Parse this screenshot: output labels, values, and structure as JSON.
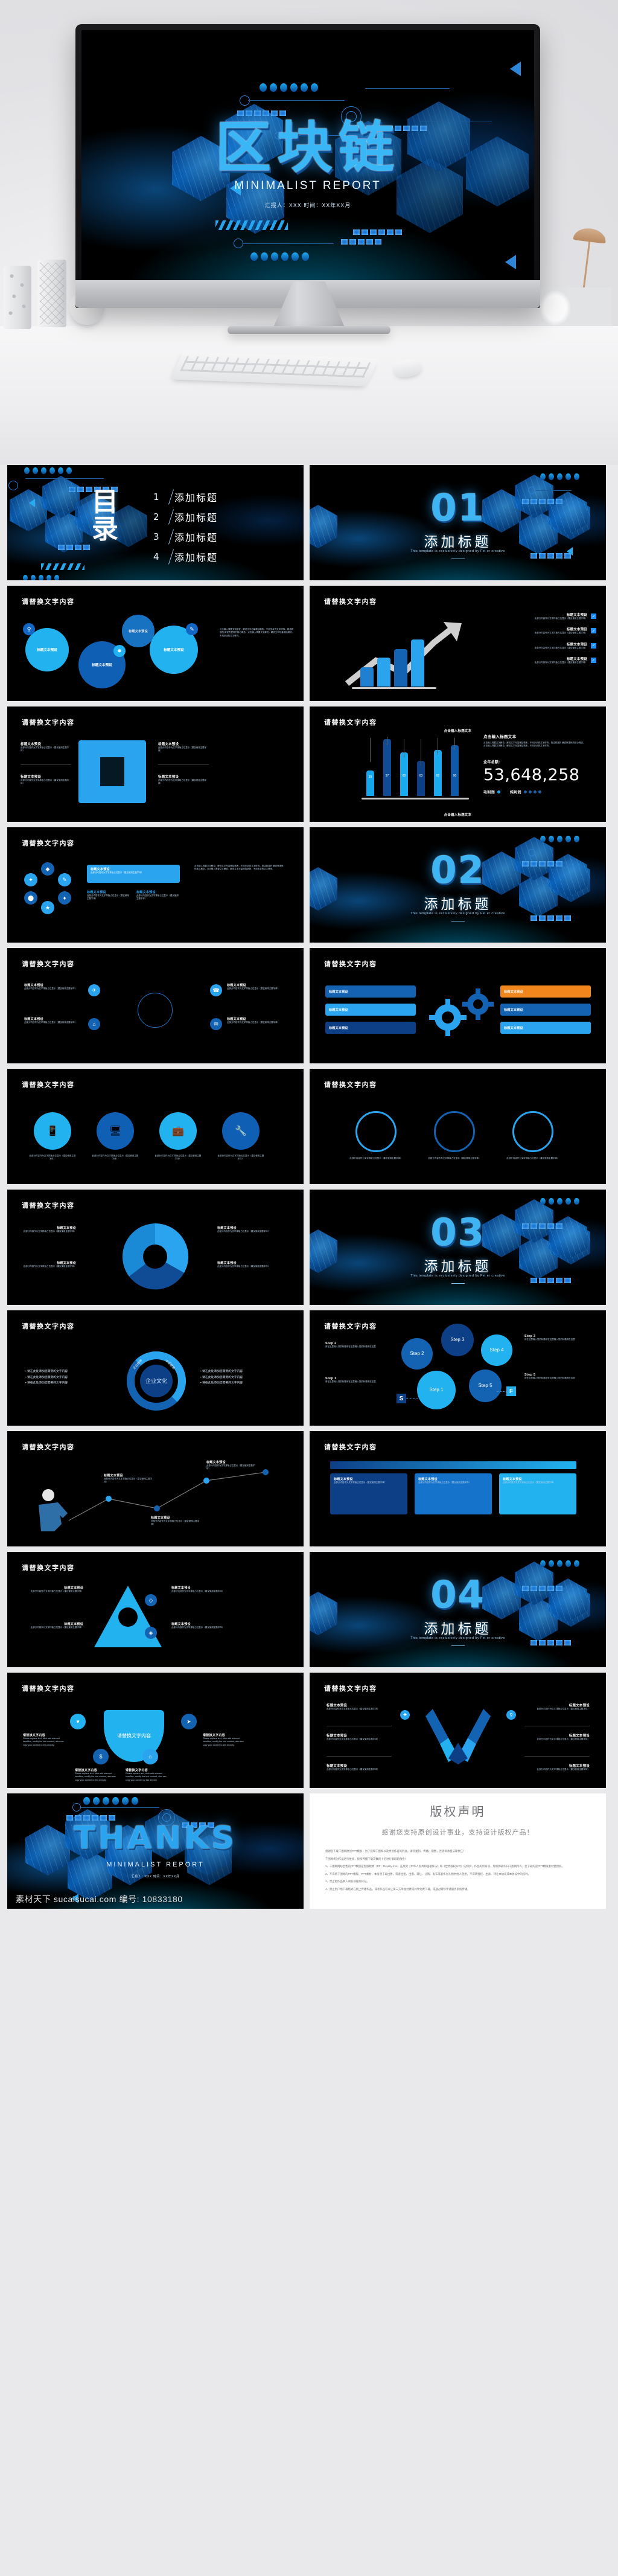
{
  "hero": {
    "title": "区块链",
    "subtitle": "MINIMALIST  REPORT",
    "meta": "汇报人：XXX  时间：XX年XX月"
  },
  "contents": {
    "heading": "目录",
    "items": [
      {
        "n": "1",
        "label": "添加标题"
      },
      {
        "n": "2",
        "label": "添加标题"
      },
      {
        "n": "3",
        "label": "添加标题"
      },
      {
        "n": "4",
        "label": "添加标题"
      }
    ]
  },
  "sections": [
    {
      "num": "01",
      "title": "添加标题",
      "en": "This template is exclusively designed by Fei er creative"
    },
    {
      "num": "02",
      "title": "添加标题",
      "en": "This template is exclusively designed by Fei er creative"
    },
    {
      "num": "03",
      "title": "添加标题",
      "en": "This template is exclusively designed by Fei er creative"
    },
    {
      "num": "04",
      "title": "添加标题",
      "en": "This template is exclusively designed by Fei er creative"
    }
  ],
  "common": {
    "slide_heading": "请替换文字内容",
    "preset_title": "标题文本预设",
    "preset_body": "此部分内容作为文字排版占位显示（建议使用主题字体）",
    "bullet_text": "请在此处添加您需要的文字内容",
    "input_title": "点击输入标题文本",
    "input_body": "点击输入简要文字解说，解说文字尽量概括精炼，不用多余的文字修饰。简洁精准的 解说所提炼的核心概念。点击输入简要文字解说，解说文字尽量概括精炼，不用多余的文字修饰。",
    "replace_text": "请替换文字内容",
    "en_body": "Please replace text, click add relevant headline, modify the text content, also can copy your content to this directly.",
    "step_body": "请在这里输入您的标题请在这里输入您的标题请在这里"
  },
  "chart_slide": {
    "heading": "请替换文字内容",
    "right_title": "点击输入标题文本",
    "right_body": "点击输入简要文字解说，解说文字尽量概括精炼，不用多余的文字修饰。简洁精准的 解说所提炼的核心概念。点击输入简要文字解说，解说文字尽量概括精炼，不用多余的文字修饰。",
    "total_label": "全年总额：",
    "total_value": "53,648,258",
    "legend": [
      "毛利润",
      "纯利润"
    ],
    "caption_top": "点击输入标题文本",
    "caption_bottom": "点击输入标题文本"
  },
  "chart_data": {
    "type": "bar",
    "categories": [
      "1",
      "2",
      "3",
      "4",
      "5",
      "6"
    ],
    "values": [
      39,
      97,
      80,
      63,
      82,
      90
    ],
    "colors": [
      "#14a6ea",
      "#0f4c95",
      "#18a9ef",
      "#0d3f86",
      "#1aaaf0",
      "#0f5aa8"
    ],
    "title": "点击输入标题文本",
    "xlabel": "点击输入标题文本",
    "ylabel": "",
    "ylim": [
      0,
      100
    ],
    "grid": false,
    "legend": [
      "毛利润",
      "纯利润"
    ]
  },
  "growth_slide": {
    "heading": "请替换文字内容",
    "items": [
      "标题文本预设",
      "标题文本预设",
      "标题文本预设",
      "标题文本预设"
    ]
  },
  "puzzle_slide": {
    "heading": "请替换文字内容",
    "left": [
      "标题文本预设",
      "标题文本预设"
    ],
    "right": [
      "标题文本预设",
      "标题文本预设"
    ]
  },
  "culture_slide": {
    "heading": "请替换文字内容",
    "center": "企业文化",
    "ring_labels": [
      "企业精神",
      "企业愿景",
      "企业使命",
      "企业价值"
    ],
    "bullets_left": [
      "请在此处添加您需要的文字内容",
      "请在此处添加您需要的文字内容",
      "请在此处添加您需要的文字内容"
    ],
    "bullets_right": [
      "请在此处添加您需要的文字内容",
      "请在此处添加您需要的文字内容",
      "请在此处添加您需要的文字内容"
    ]
  },
  "steps_slide": {
    "heading": "请替换文字内容",
    "start": "S",
    "finish": "F",
    "steps": [
      "Step 1",
      "Step 2",
      "Step 3",
      "Step 4",
      "Step 5"
    ],
    "body": "请在这里输入您的标题请在这里输入您的标题请在这里"
  },
  "fan_slide": {
    "heading": "请替换文字内容",
    "center": "请替换文字内容",
    "items": [
      "请替换文字内容",
      "请替换文字内容",
      "请替换文字内容",
      "请替换文字内容"
    ],
    "body": "Please replace text, click add relevant headline, modify the text content, also can copy your content to this directly.",
    "icons": [
      "heart-icon",
      "cursor-icon",
      "dollar-icon",
      "home-icon"
    ]
  },
  "vee_slide": {
    "heading": "请替换文字内容",
    "items": [
      "标题文本预设",
      "标题文本预设",
      "标题文本预设",
      "标题文本预设",
      "标题文本预设",
      "标题文本预设"
    ],
    "body": "此部分内容作为文字排版占位显示（建议使用主题字体）"
  },
  "thanks": {
    "title": "THANKS",
    "subtitle": "MINIMALIST  REPORT",
    "meta": "汇报人：XXX  时间：XX年XX月"
  },
  "copyright": {
    "title": "版权声明",
    "subtitle": "感谢您支持原创设计事业，支持设计版权产品！",
    "paragraphs": [
      "感谢您下载千图网原创PPT模板，为了您和千图网以及原创作者的利益，请勿复制、传播、销售，否则将承担法律责任！",
      "千图网将对作品进行维权，按照传播下载次数的十倍进行索取赔偿金！",
      "1、千图网网站出售的PPT模版是免版税类（RF：Royalty-free）正版受《中华人民共和国著作法》和《世界版权公约》的保护，作品的所有权、版权和著作归千图网所有，您下载的是PPT模版素材使用权。",
      "2、不得将千图网的PPT模版、PPT素材，本身用于再出售，或者出租、出借、转让、分销、发布或者作为礼物供他人使用，不得转授权、出卖、转让本协议或本协议中的权利。",
      "3、禁止把作品纳入商标或服务标记。",
      "4、禁止用户用下载格式在网上传播作品，或者作品可以让第三方单独付费或共享免费下载，或通过转移申请服务系统传播。"
    ]
  },
  "watermark": "素材天下 sucaisucai.com 编号: 10833180"
}
